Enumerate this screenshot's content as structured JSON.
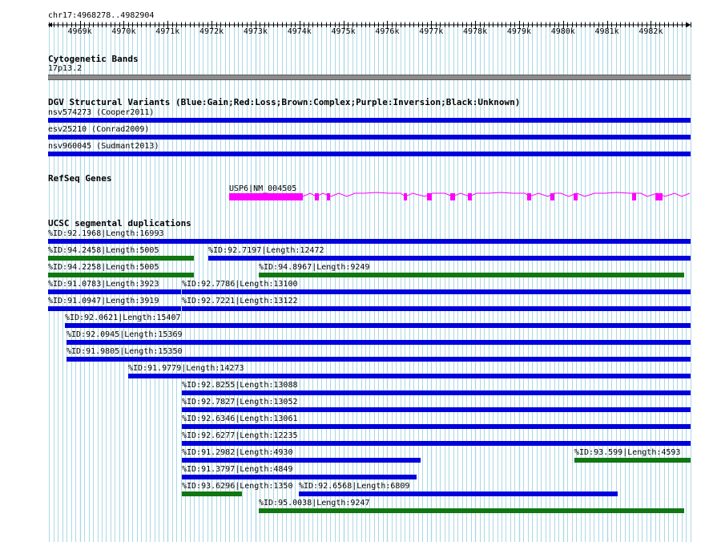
{
  "location": "chr17:4968278..4982904",
  "ruler": {
    "ticks": [
      {
        "label": "4969k",
        "kb": 4969
      },
      {
        "label": "4970k",
        "kb": 4970
      },
      {
        "label": "4971k",
        "kb": 4971
      },
      {
        "label": "4972k",
        "kb": 4972
      },
      {
        "label": "4973k",
        "kb": 4973
      },
      {
        "label": "4974k",
        "kb": 4974
      },
      {
        "label": "4975k",
        "kb": 4975
      },
      {
        "label": "4976k",
        "kb": 4976
      },
      {
        "label": "4977k",
        "kb": 4977
      },
      {
        "label": "4978k",
        "kb": 4978
      },
      {
        "label": "4979k",
        "kb": 4979
      },
      {
        "label": "4980k",
        "kb": 4980
      },
      {
        "label": "4981k",
        "kb": 4981
      },
      {
        "label": "4982k",
        "kb": 4982
      }
    ]
  },
  "colors": {
    "blue": "#0000dd",
    "green": "#117711",
    "magenta": "#ff00ff",
    "grid": "#add8e6",
    "band": "#8c8c8c"
  },
  "tracks": {
    "cytoband": {
      "title": "Cytogenetic Bands",
      "band": "17p13.2"
    },
    "dgv": {
      "title": "DGV Structural Variants (Blue:Gain;Red:Loss;Brown:Complex;Purple:Inversion;Black:Unknown)",
      "features": [
        {
          "label": "nsv574273 (Cooper2011)",
          "color": "blue"
        },
        {
          "label": "esv25210 (Conrad2009)",
          "color": "blue"
        },
        {
          "label": "nsv960045 (Sudmant2013)",
          "color": "blue"
        }
      ]
    },
    "refseq": {
      "title": "RefSeq Genes",
      "gene": "USP6|NM_004505"
    },
    "segdups": {
      "title": "UCSC segmental duplications",
      "features": [
        {
          "label": "%ID:92.1968|Length:16993",
          "color": "blue"
        },
        {
          "label": "%ID:94.2458|Length:5005",
          "color": "green"
        },
        {
          "label": "%ID:92.7197|Length:12472",
          "color": "blue"
        },
        {
          "label": "%ID:94.2258|Length:5005",
          "color": "green"
        },
        {
          "label": "%ID:94.8967|Length:9249",
          "color": "green"
        },
        {
          "label": "%ID:91.0783|Length:3923",
          "color": "blue"
        },
        {
          "label": "%ID:92.7786|Length:13100",
          "color": "blue"
        },
        {
          "label": "%ID:91.0947|Length:3919",
          "color": "blue"
        },
        {
          "label": "%ID:92.7221|Length:13122",
          "color": "blue"
        },
        {
          "label": "%ID:92.0621|Length:15407",
          "color": "blue"
        },
        {
          "label": "%ID:92.0945|Length:15369",
          "color": "blue"
        },
        {
          "label": "%ID:91.9805|Length:15350",
          "color": "blue"
        },
        {
          "label": "%ID:91.9779|Length:14273",
          "color": "blue"
        },
        {
          "label": "%ID:92.8255|Length:13088",
          "color": "blue"
        },
        {
          "label": "%ID:92.7827|Length:13052",
          "color": "blue"
        },
        {
          "label": "%ID:92.6346|Length:13061",
          "color": "blue"
        },
        {
          "label": "%ID:92.6277|Length:12235",
          "color": "blue"
        },
        {
          "label": "%ID:91.2982|Length:4930",
          "color": "blue"
        },
        {
          "label": "%ID:93.599|Length:4593",
          "color": "green"
        },
        {
          "label": "%ID:91.3797|Length:4849",
          "color": "blue"
        },
        {
          "label": "%ID:93.6296|Length:1350",
          "color": "green"
        },
        {
          "label": "%ID:92.6568|Length:6809",
          "color": "blue"
        },
        {
          "label": "%ID:95.0038|Length:9247",
          "color": "green"
        }
      ]
    }
  }
}
